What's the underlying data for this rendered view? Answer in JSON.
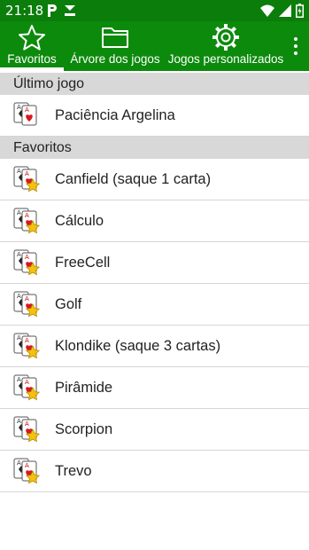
{
  "status_bar": {
    "time": "21:18",
    "left_icons": [
      "p-notification-icon",
      "download-icon"
    ],
    "right_icons": [
      "wifi-icon",
      "signal-icon",
      "battery-icon"
    ]
  },
  "toolbar": {
    "background": "#0c8a0c",
    "tabs": [
      {
        "label": "Favoritos",
        "icon": "star-icon",
        "active": true
      },
      {
        "label": "Árvore dos jogos",
        "icon": "folder-icon",
        "active": false
      },
      {
        "label": "Jogos personalizados",
        "icon": "gear-icon",
        "active": false
      }
    ]
  },
  "sections": [
    {
      "title": "Último jogo",
      "items": [
        {
          "label": "Paciência Argelina",
          "favorite": false
        }
      ]
    },
    {
      "title": "Favoritos",
      "items": [
        {
          "label": "Canfield (saque 1 carta)",
          "favorite": true
        },
        {
          "label": "Cálculo",
          "favorite": true
        },
        {
          "label": "FreeCell",
          "favorite": true
        },
        {
          "label": "Golf",
          "favorite": true
        },
        {
          "label": "Klondike (saque 3 cartas)",
          "favorite": true
        },
        {
          "label": "Pirâmide",
          "favorite": true
        },
        {
          "label": "Scorpion",
          "favorite": true
        },
        {
          "label": "Trevo",
          "favorite": true
        }
      ]
    }
  ]
}
